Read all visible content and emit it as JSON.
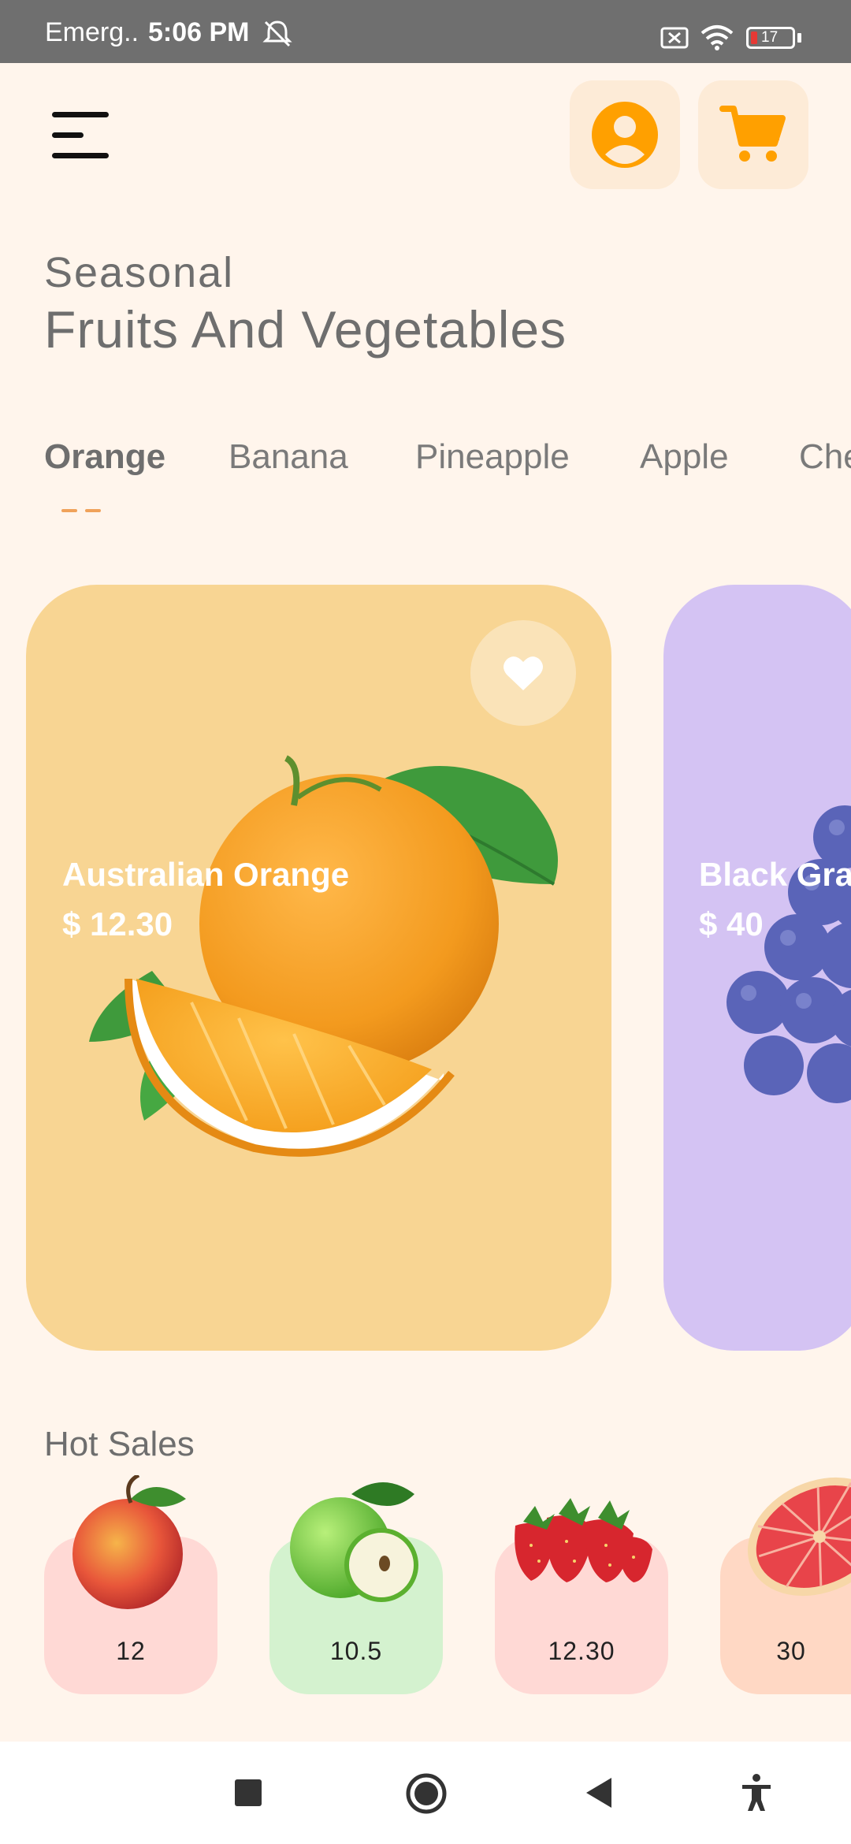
{
  "status_bar": {
    "carrier": "Emerg..",
    "time": "5:06 PM",
    "battery": "17"
  },
  "header": {
    "menu_icon": "hamburger-menu-icon",
    "profile_icon": "user-profile-icon",
    "cart_icon": "shopping-cart-icon",
    "accent_color": "#FFA000"
  },
  "title": {
    "line1": "Seasonal",
    "line2": "Fruits And Vegetables"
  },
  "tabs": [
    {
      "label": "Orange",
      "active": true
    },
    {
      "label": "Banana",
      "active": false
    },
    {
      "label": "Pineapple",
      "active": false
    },
    {
      "label": "Apple",
      "active": false
    },
    {
      "label": "Che",
      "active": false
    }
  ],
  "cards": [
    {
      "name": "Australian Orange",
      "price": "$ 12.30",
      "color": "#F8D593",
      "icon": "heart-icon"
    },
    {
      "name": "Black Gra",
      "price": "$ 40",
      "color": "#D4C3F3"
    }
  ],
  "hot_sales": {
    "title": "Hot Sales",
    "items": [
      {
        "value": "12",
        "fruit": "peach",
        "color": "#FFD9D5"
      },
      {
        "value": "10.5",
        "fruit": "green-apple",
        "color": "#D4F2CF"
      },
      {
        "value": "12.30",
        "fruit": "strawberries",
        "color": "#FFD9D5"
      },
      {
        "value": "30",
        "fruit": "grapefruit",
        "color": "#FFD8C4"
      }
    ]
  },
  "nav_bar": {
    "recents_icon": "square-recents-icon",
    "home_icon": "circle-home-icon",
    "back_icon": "triangle-back-icon",
    "accessibility_icon": "accessibility-icon"
  }
}
